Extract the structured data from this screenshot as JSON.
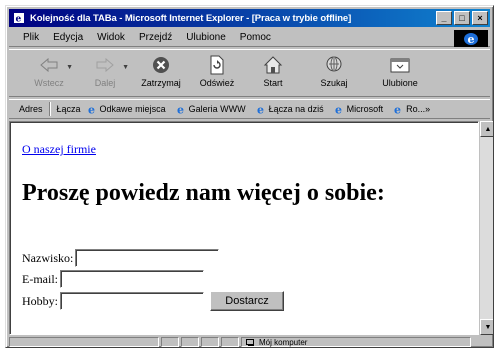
{
  "window": {
    "title": "Kolejność dla TABa - Microsoft Internet Explorer - [Praca w trybie offline]",
    "controls": {
      "minimize": "_",
      "maximize": "□",
      "close": "×"
    }
  },
  "menu": [
    "Plik",
    "Edycja",
    "Widok",
    "Przejdź",
    "Ulubione",
    "Pomoc"
  ],
  "toolbar": [
    {
      "label": "Wstecz",
      "icon": "back-arrow-icon",
      "disabled": true,
      "dropdown": true
    },
    {
      "label": "Dalej",
      "icon": "forward-arrow-icon",
      "disabled": true,
      "dropdown": true
    },
    {
      "label": "Zatrzymaj",
      "icon": "stop-icon",
      "disabled": false
    },
    {
      "label": "Odśwież",
      "icon": "refresh-icon",
      "disabled": false
    },
    {
      "label": "Start",
      "icon": "home-icon",
      "disabled": false
    },
    {
      "label": "Szukaj",
      "icon": "search-icon",
      "disabled": false
    },
    {
      "label": "Ulubione",
      "icon": "favorites-icon",
      "disabled": false
    }
  ],
  "linksbar": {
    "address_label": "Adres",
    "links_label": "Łącza",
    "links": [
      "Odkawe miejsca",
      "Galeria WWW",
      "Łącza na dziś",
      "Microsoft",
      "Ro..."
    ],
    "more": "»"
  },
  "page": {
    "link": "O naszej firmie",
    "heading": "Proszę powiedz nam więcej o sobie:",
    "fields": [
      {
        "label": "Nazwisko:",
        "value": ""
      },
      {
        "label": "E-mail:",
        "value": ""
      },
      {
        "label": "Hobby:",
        "value": ""
      }
    ],
    "submit": "Dostarcz"
  },
  "status": {
    "zone": "Mój komputer"
  }
}
